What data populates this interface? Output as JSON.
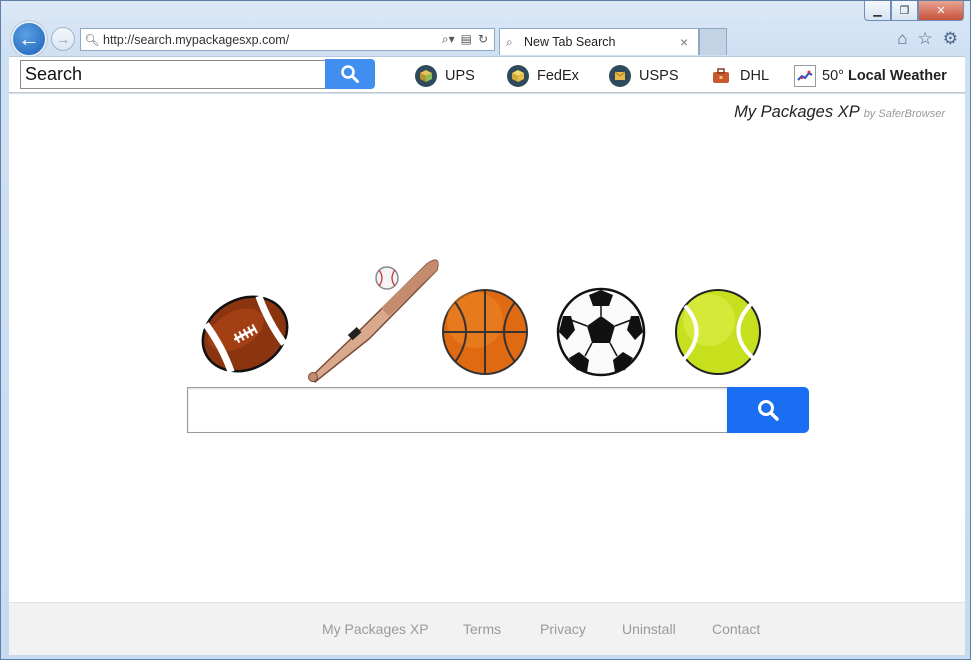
{
  "browser": {
    "url": "http://search.mypackagesxp.com/",
    "tab_title": "New Tab Search"
  },
  "toolbar": {
    "search_value": "Search",
    "carriers": [
      {
        "label": "UPS",
        "icon": "ups-icon"
      },
      {
        "label": "FedEx",
        "icon": "fedex-icon"
      },
      {
        "label": "USPS",
        "icon": "usps-icon"
      },
      {
        "label": "DHL",
        "icon": "dhl-icon"
      }
    ],
    "weather": {
      "temp": "50°",
      "label": "Local Weather"
    }
  },
  "brand": {
    "name": "My Packages XP",
    "by": "by SaferBrowser"
  },
  "sports_icons": [
    "football-icon",
    "baseball-bat-icon",
    "baseball-icon",
    "basketball-icon",
    "soccer-ball-icon",
    "tennis-ball-icon"
  ],
  "footer": {
    "links": [
      "My Packages XP",
      "Terms",
      "Privacy",
      "Uninstall",
      "Contact"
    ]
  },
  "colors": {
    "search_button": "#1a6ef2",
    "toolbar_search_button": "#3f8ef0"
  }
}
